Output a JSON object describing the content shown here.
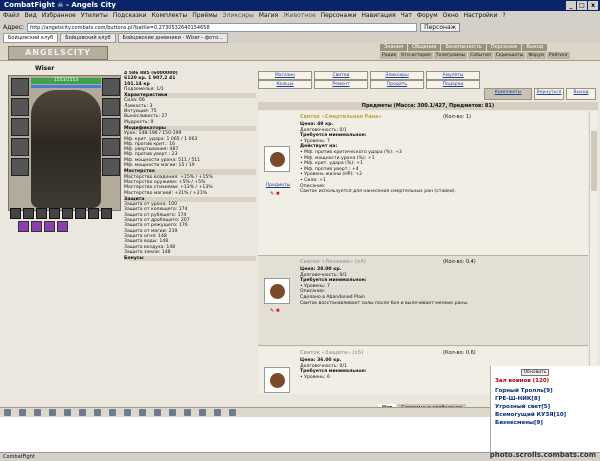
{
  "window": {
    "title": "CombatFight  ☠ - Angels City",
    "controls": [
      "_",
      "□",
      "x"
    ]
  },
  "menu": [
    "Файл",
    "Вид",
    "Избранное",
    "Утилиты",
    "Подсказки",
    "Комплекты",
    "Приёмы",
    "Эликсиры",
    "Магия",
    "Животное",
    "Персонажи",
    "Навигация",
    "Чат",
    "Форум",
    "Окно",
    "Настройки",
    "?"
  ],
  "address": {
    "label": "Адрес:",
    "url": "http://angelscity.combats.com/buttons.pl?battle=0.2730532640154658",
    "button": "Персонаж"
  },
  "tabs": [
    {
      "label": "Бойцовский клуб"
    },
    {
      "label": "Бойцовский клуб"
    },
    {
      "label": "Бойцовские дневники - Wiser - фото..."
    }
  ],
  "game": {
    "logo": "ANGELSCITY",
    "nav_top": [
      "Знания",
      "Общение",
      "Безопасность",
      "Персонаж",
      "Выход"
    ],
    "nav_sub": [
      "Радио",
      "Кто-история",
      "Телеграммы",
      "События",
      "Скриншоты",
      "Форум",
      "Рейтинг"
    ],
    "hp": "1553/1553",
    "character": {
      "name": "Wiser"
    },
    "stats": [
      {
        "t": "b",
        "v": "4 586 885 (6000000)"
      },
      {
        "t": "b",
        "v": "6120 кр.   1 907,2   41"
      },
      {
        "t": "b",
        "v": "101.14 кр"
      },
      {
        "t": "",
        "v": "Подземелья: 1/1"
      },
      {
        "t": "sec",
        "v": "Характеристики"
      },
      {
        "t": "",
        "v": "Сила: 66"
      },
      {
        "t": "",
        "v": "Ловкость: 3"
      },
      {
        "t": "",
        "v": "Интуиция: 75"
      },
      {
        "t": "",
        "v": "Выносливость: 27"
      },
      {
        "t": "",
        "v": "Мудрость: 9"
      },
      {
        "t": "sec",
        "v": "Модификаторы"
      },
      {
        "t": "",
        "v": "Урон: 148-196 / 150-199"
      },
      {
        "t": "",
        "v": "Мф. крит. удара: 1 065 / 1 063"
      },
      {
        "t": "",
        "v": "Мф. против крит.: 16"
      },
      {
        "t": "",
        "v": "Мф. увертывания: 487"
      },
      {
        "t": "",
        "v": "Мф. против уверт.: 23"
      },
      {
        "t": "",
        "v": "Мф. мощности урона: 511 / 511"
      },
      {
        "t": "",
        "v": "Мф. мощности магии: 15 / 19"
      },
      {
        "t": "sec",
        "v": "Мастерство"
      },
      {
        "t": "",
        "v": "Мастерство владения: +15% / +15%"
      },
      {
        "t": "",
        "v": "Мастерство оружием: +5% / +5%"
      },
      {
        "t": "",
        "v": "Мастерство стихиями: +13% / +13%"
      },
      {
        "t": "",
        "v": "Мастерство магией: +21% / +21%"
      },
      {
        "t": "sec",
        "v": "Защита"
      },
      {
        "t": "",
        "v": "Защита от урона: 100"
      },
      {
        "t": "",
        "v": "Защита от колющего: 174"
      },
      {
        "t": "",
        "v": "Защита от рубящего: 174"
      },
      {
        "t": "",
        "v": "Защита от дробящего: 207"
      },
      {
        "t": "",
        "v": "Защита от режущего: 176"
      },
      {
        "t": "",
        "v": "Защита от магии: 219"
      },
      {
        "t": "",
        "v": "Защита огня: 148"
      },
      {
        "t": "",
        "v": "Защита воды: 148"
      },
      {
        "t": "",
        "v": "Защита воздуха: 148"
      },
      {
        "t": "",
        "v": "Защита земли: 148"
      },
      {
        "t": "sec",
        "v": "Бонусы"
      }
    ],
    "top_buttons": [
      "Магазин",
      "Свитки",
      "Эликсиры",
      "Амулеты",
      "Кольца",
      "Ремонт",
      "Продать",
      "Подарки",
      "Комплекты",
      "Вернуться",
      "Выход"
    ],
    "shop_header": "Предметы (Масса: 300.1/427, Предметов: 81)",
    "items": [
      {
        "name": "Свиток «Смертельная Рана»",
        "qty": "(Кол-во: 1)",
        "buy": "Предметы",
        "lines": [
          {
            "b": true,
            "v": "Цена: 49 кр."
          },
          {
            "b": false,
            "v": "Долговечность: 0/1"
          },
          {
            "b": true,
            "v": "Требуется минимальное:"
          },
          {
            "b": false,
            "v": "• Уровень: 7"
          },
          {
            "b": true,
            "v": "Действует на:"
          },
          {
            "b": false,
            "v": "• Мф. против критического удара (%): +3"
          },
          {
            "b": false,
            "v": "• Мф. мощности урона (%): +1"
          },
          {
            "b": false,
            "v": "• Мф. крит. удара (%): +1"
          },
          {
            "b": false,
            "v": "• Мф. против уверт.: +4"
          },
          {
            "b": false,
            "v": "• Уровень жизни (HP): +2"
          },
          {
            "b": false,
            "v": "• Сила: +1"
          },
          {
            "b": false,
            "v": "Описание:"
          },
          {
            "b": false,
            "v": "Свиток используется для нанесения смертельных ран (ставки)."
          }
        ]
      },
      {
        "name": "Свиток «Лечение» (x4)",
        "qty": "(Кол-во: 0.4)",
        "buy": "",
        "lines": [
          {
            "b": true,
            "v": "Цена: 28.00 кр."
          },
          {
            "b": false,
            "v": "Долговечность: 0/1"
          },
          {
            "b": true,
            "v": "Требуется минимальное:"
          },
          {
            "b": false,
            "v": "• Уровень: 7"
          },
          {
            "b": false,
            "v": "Описание:"
          },
          {
            "b": false,
            "v": "Сделано в Abandoned Plain"
          },
          {
            "b": false,
            "v": "Свиток восстанавливает силы после боя и вылечивает мелкие раны."
          }
        ]
      },
      {
        "name": "Свиток «Защита» (x5)",
        "qty": "(Кол-во: 0.6)",
        "buy": "",
        "lines": [
          {
            "b": true,
            "v": "Цена: 36.00 кр."
          },
          {
            "b": false,
            "v": "Долговечность: 0/1"
          },
          {
            "b": true,
            "v": "Требуется минимальное:"
          },
          {
            "b": false,
            "v": "• Уровень: 6"
          }
        ]
      }
    ],
    "chat_tabs": [
      "Чат",
      "Системные сообщения"
    ],
    "room": {
      "refresh": "Обновить",
      "title": "Зал воинов (120)",
      "users": [
        "Горный Тролль[9]",
        "ГРЕ-Ш-НИК[8]",
        "Угрозный свет[5]",
        "Всемогущий КУЗЯ[10]",
        "Бизнесмены[9]"
      ]
    },
    "status": "CombatFight"
  },
  "watermark": "photo.scrolls.combats.com",
  "colors": {
    "titlebar": "#0a246a",
    "panel": "#ebe7de",
    "accent": "#c7a23e",
    "link": "#2040a0"
  }
}
